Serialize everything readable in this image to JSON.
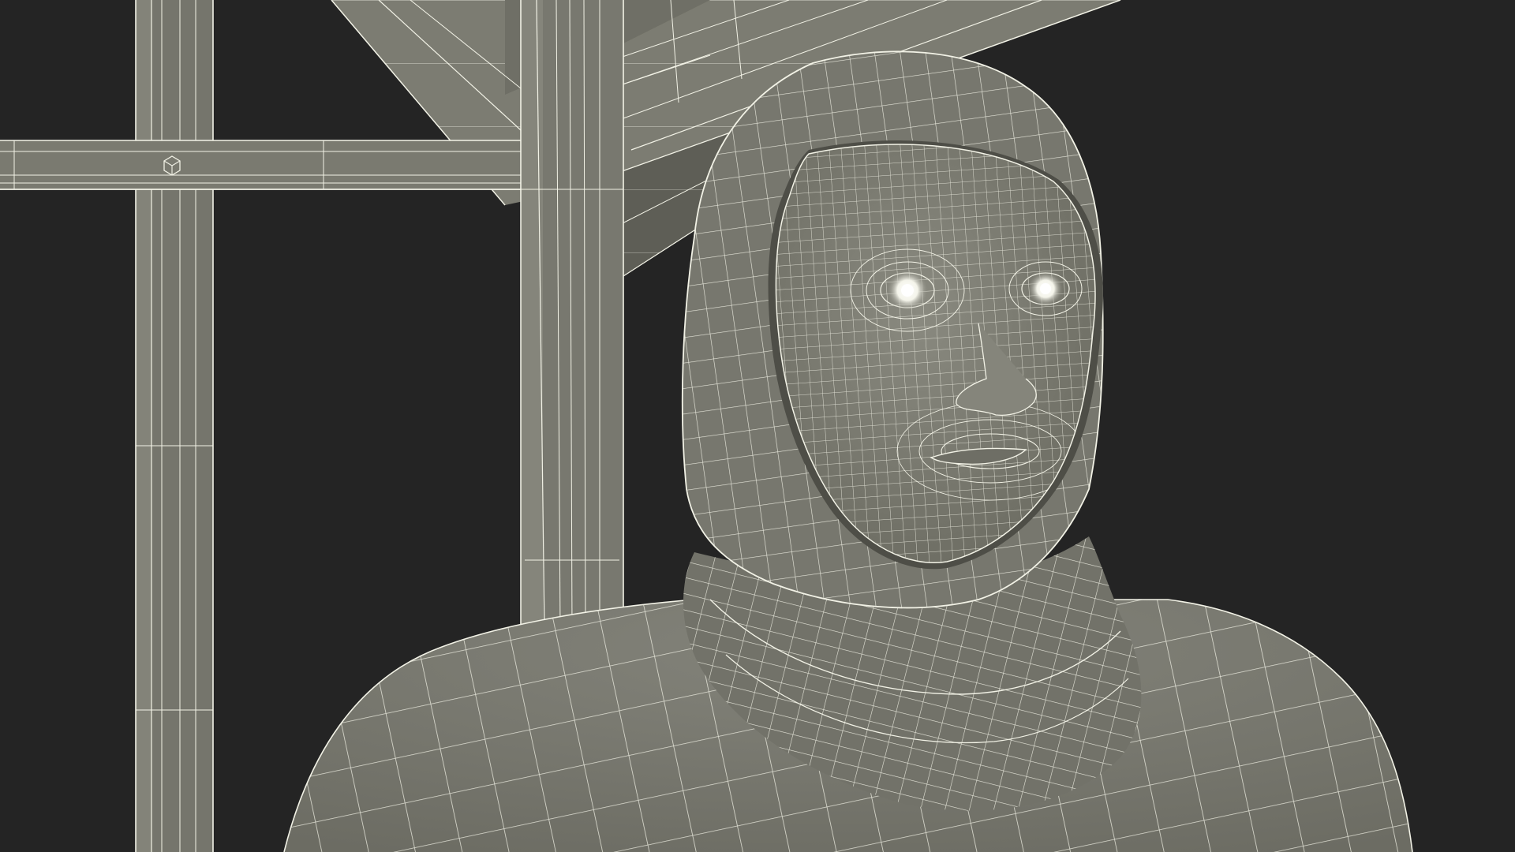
{
  "viewport": {
    "background_color": "#242424",
    "mesh_fill_color": "#7a7a70",
    "mesh_dark_color": "#66665c",
    "wire_color": "#f2f2e6",
    "eye_highlight_color": "#ffffff",
    "render_mode": "wireframe-on-shaded"
  },
  "scene": {
    "subject": "hooded-figure-mesh",
    "structure": "steel-frame-canopy",
    "pivot_icon": "cube-icon"
  }
}
